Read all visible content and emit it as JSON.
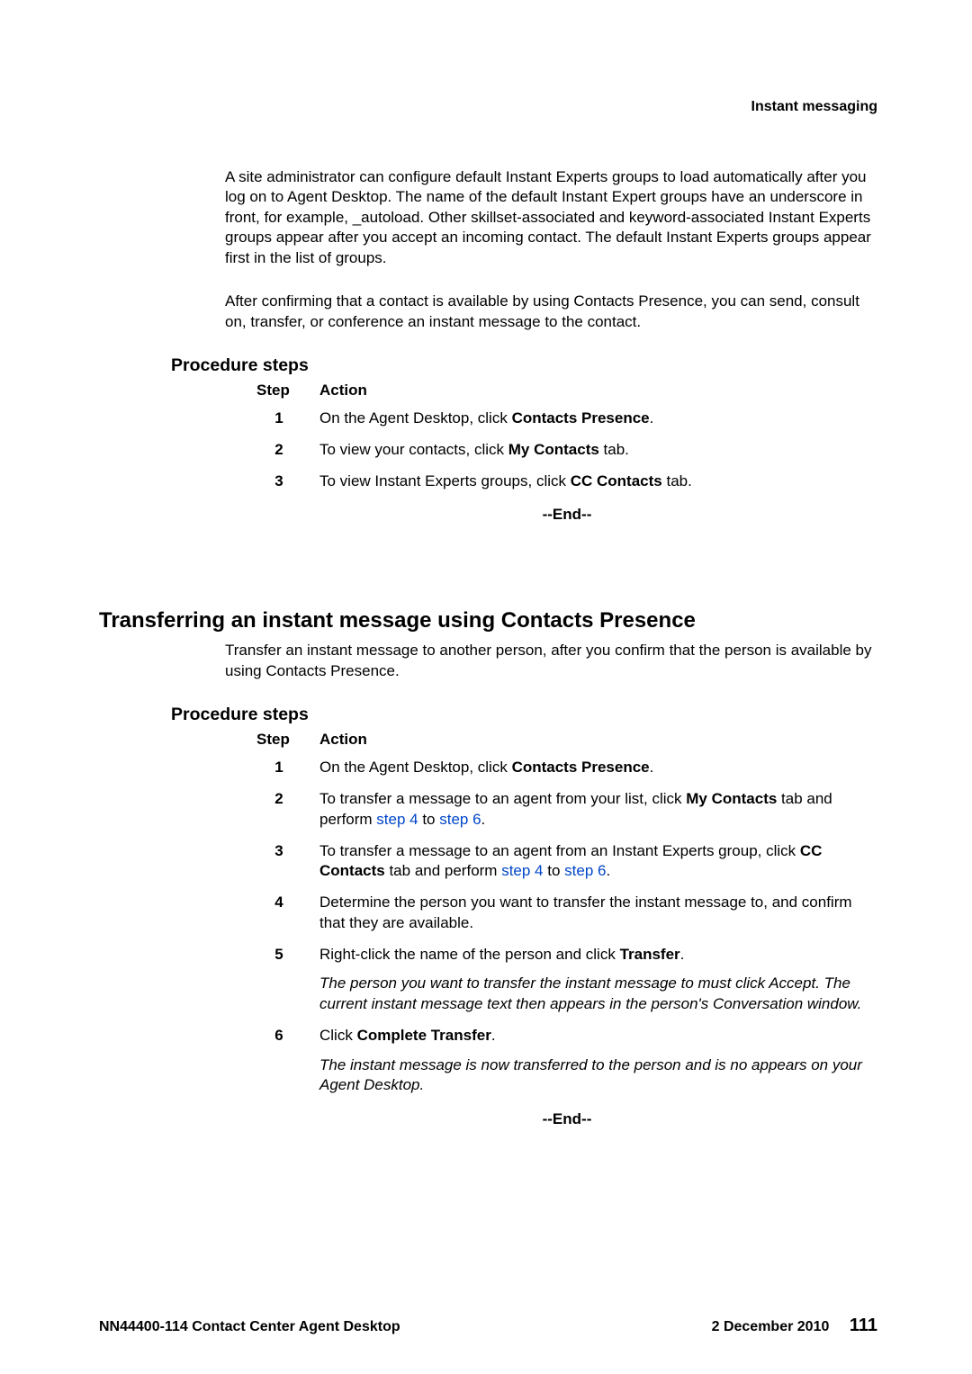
{
  "header": {
    "label": "Instant messaging"
  },
  "intro_paras": {
    "p1": "A site administrator can configure default Instant Experts groups to load automatically after you log on to Agent Desktop. The name of the default Instant Expert groups have an underscore in front, for example, _autoload. Other skillset-associated and keyword-associated Instant Experts groups appear after you accept an incoming contact. The default Instant Experts groups appear first in the list of groups.",
    "p2": "After confirming that a contact is available by using Contacts Presence, you can send, consult on, transfer, or conference an instant message to the contact."
  },
  "proc1": {
    "heading": "Procedure steps",
    "col_step": "Step",
    "col_action": "Action",
    "steps": {
      "s1": {
        "num": "1",
        "pre": "On the Agent Desktop, click ",
        "bold": "Contacts Presence",
        "post": "."
      },
      "s2": {
        "num": "2",
        "pre": "To view your contacts, click ",
        "bold": "My Contacts",
        "post": " tab."
      },
      "s3": {
        "num": "3",
        "pre": "To view Instant Experts groups, click ",
        "bold": "CC Contacts",
        "post": " tab."
      }
    },
    "end": "--End--"
  },
  "section2": {
    "title": "Transferring an instant message using Contacts Presence",
    "intro": "Transfer an instant message to another person, after you confirm that the person is available by using Contacts Presence."
  },
  "proc2": {
    "heading": "Procedure steps",
    "col_step": "Step",
    "col_action": "Action",
    "steps": {
      "s1": {
        "num": "1",
        "pre": "On the Agent Desktop, click ",
        "bold": "Contacts Presence",
        "post": "."
      },
      "s2": {
        "num": "2",
        "pre": "To transfer a message to an agent from your list, click ",
        "bold": "My Contacts",
        "post1": " tab and perform ",
        "link1": "step 4",
        "mid": " to ",
        "link2": "step 6",
        "post2": "."
      },
      "s3": {
        "num": "3",
        "pre": "To transfer a message to an agent from an Instant Experts group, click ",
        "bold": "CC Contacts",
        "post1": " tab and perform ",
        "link1": "step 4",
        "mid": " to ",
        "link2": "step 6",
        "post2": "."
      },
      "s4": {
        "num": "4",
        "text": "Determine the person you want to transfer the instant message to, and confirm that they are available."
      },
      "s5": {
        "num": "5",
        "pre": "Right-click the name of the person and click ",
        "bold": "Transfer",
        "post": ".",
        "note": "The person you want to transfer the instant message to must click Accept. The current instant message text then appears in the person's Conversation window."
      },
      "s6": {
        "num": "6",
        "pre": "Click ",
        "bold": "Complete Transfer",
        "post": ".",
        "note": "The instant message is now transferred to the person and is no appears on your Agent Desktop."
      }
    },
    "end": "--End--"
  },
  "footer": {
    "left": "NN44400-114 Contact Center Agent Desktop",
    "date": "2 December 2010",
    "page": "111"
  }
}
